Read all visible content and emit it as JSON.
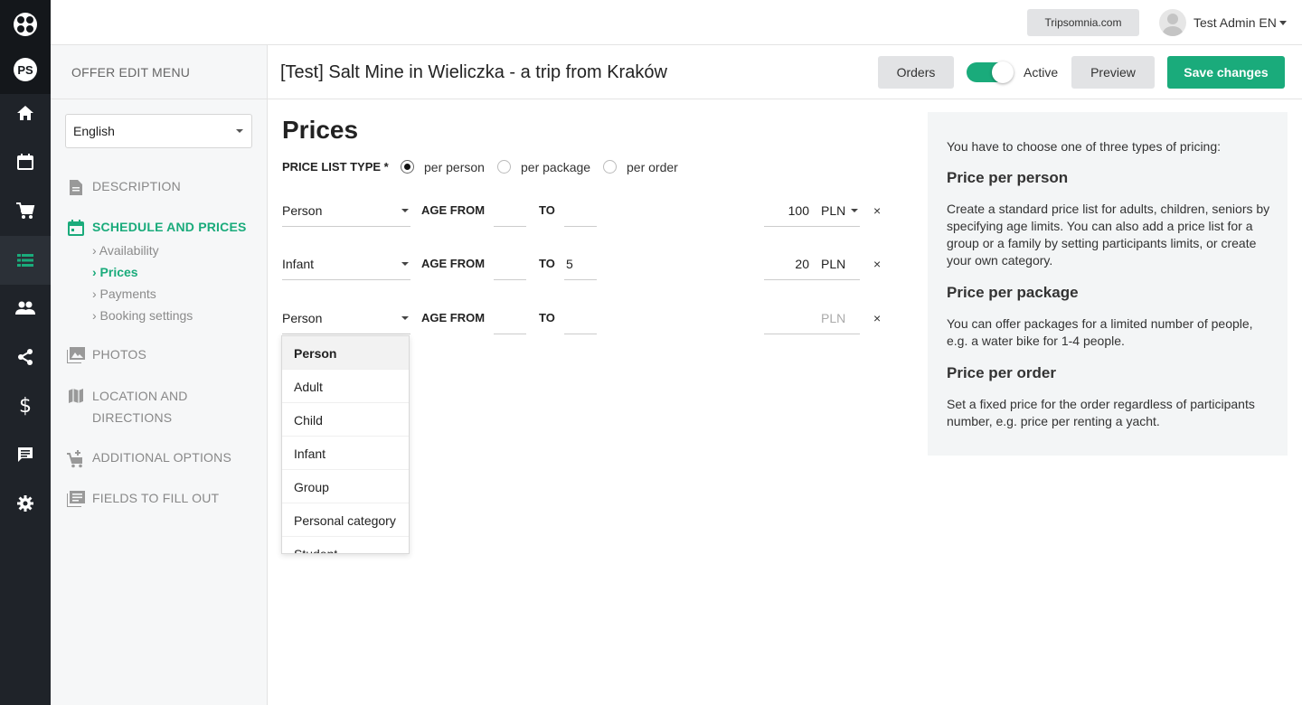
{
  "rail": {
    "items": [
      {
        "name": "logo-icon"
      },
      {
        "name": "ps-logo-icon",
        "text": "PS"
      },
      {
        "name": "home-icon"
      },
      {
        "name": "calendar-icon"
      },
      {
        "name": "cart-icon"
      },
      {
        "name": "list-icon",
        "active": true
      },
      {
        "name": "people-icon"
      },
      {
        "name": "share-icon"
      },
      {
        "name": "dollar-icon",
        "text": "$"
      },
      {
        "name": "chat-icon"
      },
      {
        "name": "gear-icon"
      }
    ]
  },
  "topbar": {
    "site_button": "Tripsomnia.com",
    "user_name": "Test Admin EN"
  },
  "menu": {
    "title": "OFFER EDIT MENU",
    "language": "English",
    "items": [
      {
        "label": "DESCRIPTION",
        "icon": "document-icon"
      },
      {
        "label": "SCHEDULE AND PRICES",
        "icon": "calendar-icon",
        "active": true
      },
      {
        "label": "PHOTOS",
        "icon": "photo-icon"
      },
      {
        "label": "LOCATION AND",
        "label2": "DIRECTIONS",
        "icon": "map-icon"
      },
      {
        "label": "ADDITIONAL OPTIONS",
        "icon": "add-cart-icon"
      },
      {
        "label": "FIELDS TO FILL OUT",
        "icon": "form-icon"
      }
    ],
    "subitems": [
      {
        "label": "› Availability"
      },
      {
        "label": "› Prices",
        "active": true
      },
      {
        "label": "› Payments"
      },
      {
        "label": "› Booking settings"
      }
    ]
  },
  "header": {
    "title": "[Test] Salt Mine in Wieliczka - a trip from Kraków",
    "orders_label": "Orders",
    "active_label": "Active",
    "active_on": true,
    "preview_label": "Preview",
    "save_label": "Save changes"
  },
  "prices": {
    "heading": "Prices",
    "list_type_label": "PRICE LIST TYPE *",
    "types": [
      {
        "label": "per person",
        "selected": true
      },
      {
        "label": "per package",
        "selected": false
      },
      {
        "label": "per order",
        "selected": false
      }
    ],
    "age_from_label": "AGE FROM",
    "to_label": "TO",
    "remove_label": "×",
    "rows": [
      {
        "category": "Person",
        "age_from": "",
        "age_to": "",
        "price": "100",
        "currency": "PLN",
        "currency_dropdown": true
      },
      {
        "category": "Infant",
        "age_from": "",
        "age_to": "5",
        "price": "20",
        "currency": "PLN",
        "currency_dropdown": false
      },
      {
        "category": "Person",
        "age_from": "",
        "age_to": "",
        "price": "",
        "currency": "PLN",
        "currency_dropdown": false
      }
    ],
    "dropdown_options": [
      "Person",
      "Adult",
      "Child",
      "Infant",
      "Group",
      "Personal category",
      "Student"
    ],
    "dropdown_selected": "Person"
  },
  "info": {
    "intro": "You have to choose one of three types of pricing:",
    "sections": [
      {
        "title": "Price per person",
        "text": "Create a standard price list for adults, children, seniors by specifying age limits. You can also add a price list for a group or a family by setting participants limits, or create your own category."
      },
      {
        "title": "Price per package",
        "text": "You can offer packages for a limited number of people, e.g. a water bike for 1-4 people."
      },
      {
        "title": "Price per order",
        "text": "Set a fixed price for the order regardless of participants number, e.g. price per renting a yacht."
      }
    ]
  },
  "colors": {
    "accent": "#1aab7b",
    "rail_bg": "#1f2329",
    "panel_bg": "#f3f5f6"
  }
}
